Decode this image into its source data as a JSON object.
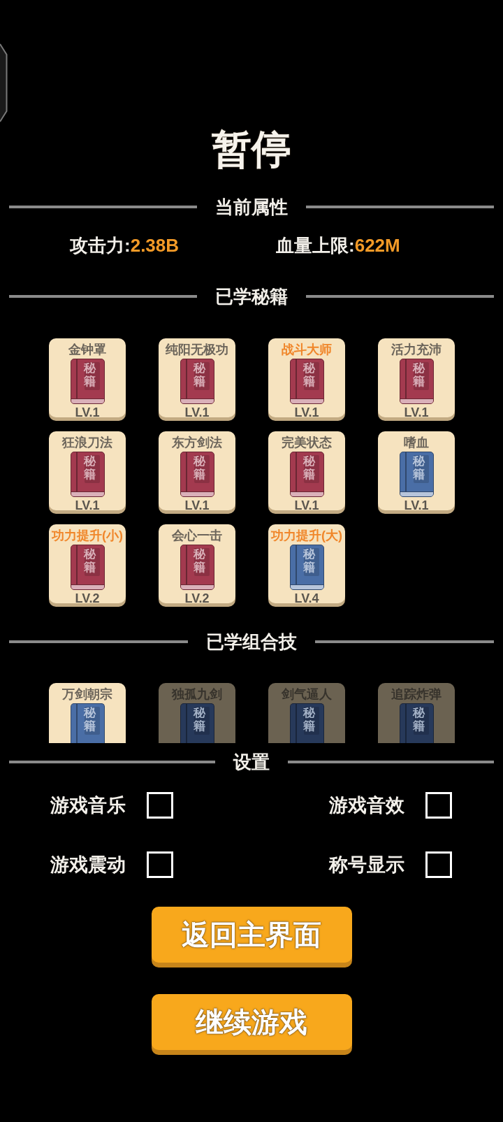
{
  "title": "暂停",
  "attributes": {
    "heading": "当前属性",
    "stats": [
      {
        "label": "攻击力:",
        "value": "2.38B"
      },
      {
        "label": "血量上限:",
        "value": "622M"
      }
    ]
  },
  "secrets": {
    "heading": "已学秘籍",
    "cards": [
      {
        "name": "金钟罩",
        "highlighted": false,
        "cover": "秘籍",
        "color": "#a33a4f",
        "tier": "LV.1"
      },
      {
        "name": "纯阳无极功",
        "highlighted": false,
        "cover": "秘籍",
        "color": "#a33a4f",
        "tier": "LV.1"
      },
      {
        "name": "战斗大师",
        "highlighted": true,
        "cover": "秘籍",
        "color": "#a33a4f",
        "tier": "LV.1"
      },
      {
        "name": "活力充沛",
        "highlighted": false,
        "cover": "秘籍",
        "color": "#a33a4f",
        "tier": "LV.1"
      },
      {
        "name": "狂浪刀法",
        "highlighted": false,
        "cover": "秘籍",
        "color": "#a33a4f",
        "tier": "LV.1"
      },
      {
        "name": "东方剑法",
        "highlighted": false,
        "cover": "秘籍",
        "color": "#a33a4f",
        "tier": "LV.1"
      },
      {
        "name": "完美状态",
        "highlighted": false,
        "cover": "秘籍",
        "color": "#a33a4f",
        "tier": "LV.1"
      },
      {
        "name": "嗜血",
        "highlighted": false,
        "cover": "秘籍",
        "color": "#4a6ea6",
        "tier": "LV.1"
      },
      {
        "name": "功力提升(小)",
        "highlighted": true,
        "cover": "秘籍",
        "color": "#a33a4f",
        "tier": "LV.2"
      },
      {
        "name": "会心一击",
        "highlighted": false,
        "cover": "秘籍",
        "color": "#a33a4f",
        "tier": "LV.2"
      },
      {
        "name": "功力提升(大)",
        "highlighted": true,
        "cover": "秘籍",
        "color": "#4a6ea6",
        "tier": "LV.4"
      }
    ]
  },
  "combos": {
    "heading": "已学组合技",
    "cards": [
      {
        "name": "万剑朝宗",
        "learned": true,
        "cover": "秘籍"
      },
      {
        "name": "独孤九剑",
        "learned": false,
        "cover": "秘籍"
      },
      {
        "name": "剑气逼人",
        "learned": false,
        "cover": "秘籍"
      },
      {
        "name": "追踪炸弹",
        "learned": false,
        "cover": "秘籍"
      }
    ]
  },
  "settings": {
    "heading": "设置",
    "options": [
      {
        "label": "游戏音乐",
        "checked": false
      },
      {
        "label": "游戏音效",
        "checked": false
      },
      {
        "label": "游戏震动",
        "checked": false
      },
      {
        "label": "称号显示",
        "checked": false
      }
    ]
  },
  "buttons": [
    {
      "label": "返回主界面"
    },
    {
      "label": "继续游戏"
    }
  ]
}
